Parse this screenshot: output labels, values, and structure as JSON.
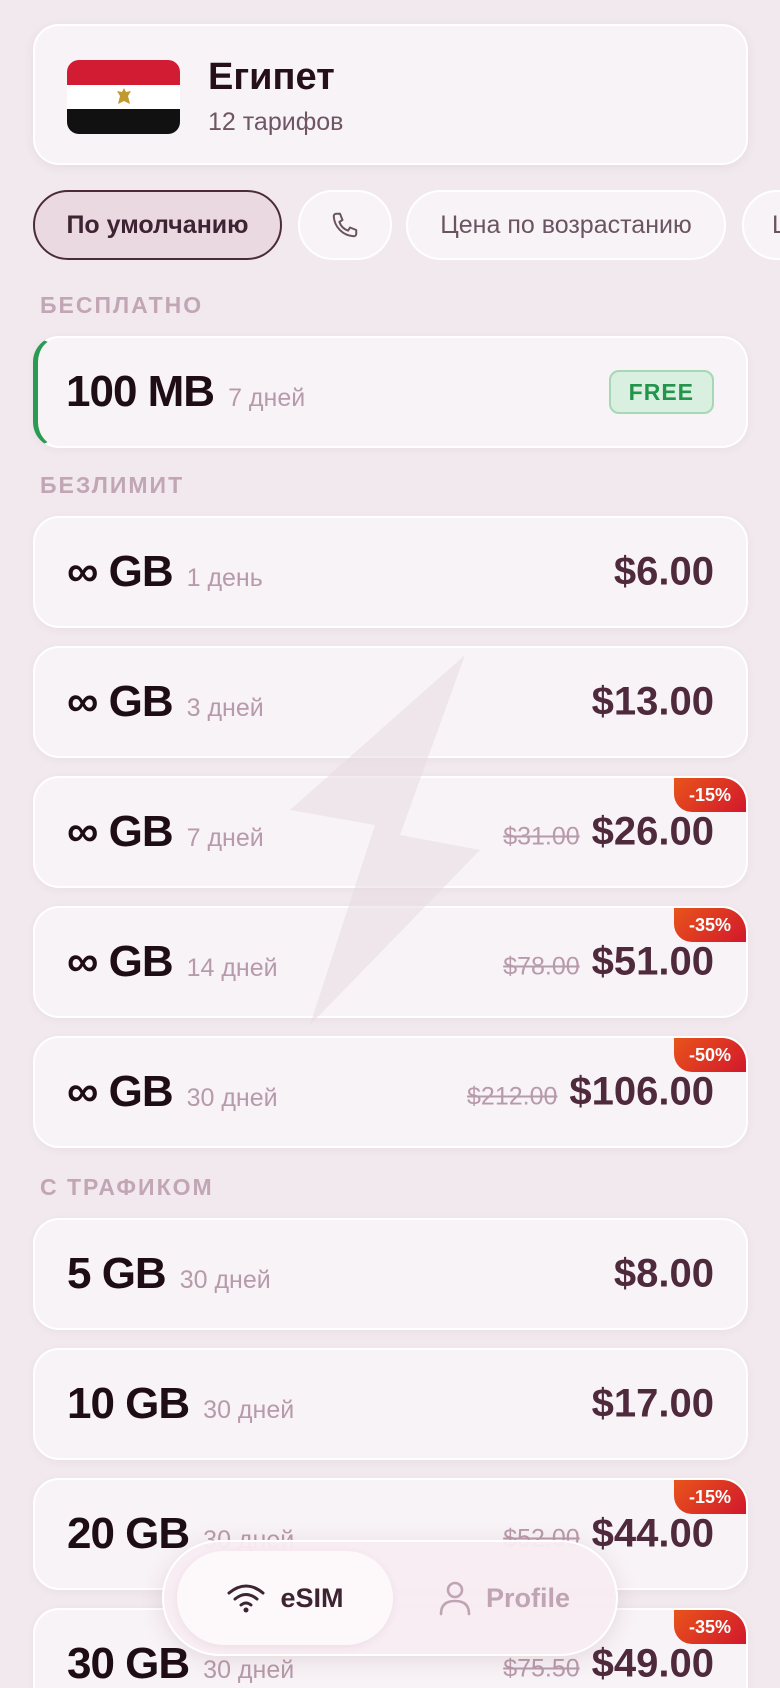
{
  "country": {
    "name": "Египет",
    "plan_count": "12 тарифов",
    "flag_icon": "egypt-flag-icon"
  },
  "filters": {
    "default_label": "По умолчанию",
    "phone_icon": "phone-icon",
    "price_asc_label": "Цена по возрастанию",
    "more_label": "Ц"
  },
  "sections": {
    "free": "БЕСПЛАТНО",
    "unlimited": "БЕЗЛИМИТ",
    "traffic": "С ТРАФИКОМ"
  },
  "free_plan": {
    "amount": "100 MB",
    "duration": "7 дней",
    "badge": "FREE"
  },
  "unlimited_plans": [
    {
      "amount": "∞ GB",
      "duration": "1 день",
      "old_price": "",
      "price": "$6.00",
      "discount": ""
    },
    {
      "amount": "∞ GB",
      "duration": "3 дней",
      "old_price": "",
      "price": "$13.00",
      "discount": ""
    },
    {
      "amount": "∞ GB",
      "duration": "7 дней",
      "old_price": "$31.00",
      "price": "$26.00",
      "discount": "-15%"
    },
    {
      "amount": "∞ GB",
      "duration": "14 дней",
      "old_price": "$78.00",
      "price": "$51.00",
      "discount": "-35%"
    },
    {
      "amount": "∞ GB",
      "duration": "30 дней",
      "old_price": "$212.00",
      "price": "$106.00",
      "discount": "-50%"
    }
  ],
  "traffic_plans": [
    {
      "amount": "5 GB",
      "duration": "30 дней",
      "old_price": "",
      "price": "$8.00",
      "discount": ""
    },
    {
      "amount": "10 GB",
      "duration": "30 дней",
      "old_price": "",
      "price": "$17.00",
      "discount": ""
    },
    {
      "amount": "20 GB",
      "duration": "30 дней",
      "old_price": "$52.00",
      "price": "$44.00",
      "discount": "-15%"
    },
    {
      "amount": "30 GB",
      "duration": "30 дней",
      "old_price": "$75.50",
      "price": "$49.00",
      "discount": "-35%"
    }
  ],
  "nav": {
    "esim_label": "eSIM",
    "esim_icon": "wifi-icon",
    "profile_label": "Profile",
    "profile_icon": "person-icon"
  },
  "colors": {
    "background": "#f1e9ee",
    "accent_free": "#2a9b53",
    "price": "#4f2a3d",
    "discount": "#e0301f"
  }
}
